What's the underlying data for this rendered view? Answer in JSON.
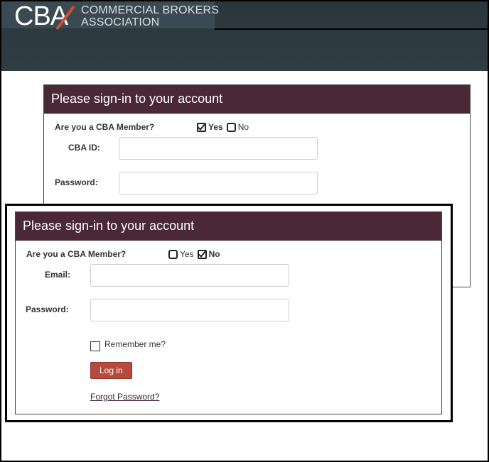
{
  "brand": {
    "logo_letters": "CBA",
    "name_line1": "COMMERCIAL BROKERS",
    "name_line2": "ASSOCIATION"
  },
  "member_panel": {
    "title": "Please sign-in to your account",
    "member_question": "Are you a CBA Member?",
    "yes_label": "Yes",
    "no_label": "No",
    "selected": "Yes",
    "id_label": "CBA ID:",
    "id_value": "",
    "password_label": "Password:",
    "password_value": ""
  },
  "nonmember_panel": {
    "title": "Please sign-in to your account",
    "member_question": "Are you a CBA Member?",
    "yes_label": "Yes",
    "no_label": "No",
    "selected": "No",
    "email_label": "Email:",
    "email_value": "",
    "password_label": "Password:",
    "password_value": "",
    "remember_label": "Remember me?",
    "remember_checked": false,
    "login_label": "Log in",
    "forgot_label": "Forgot Password?"
  },
  "colors": {
    "header": "#2c3a41",
    "panel_header": "#4b2835",
    "login_button": "#b74a3c"
  }
}
